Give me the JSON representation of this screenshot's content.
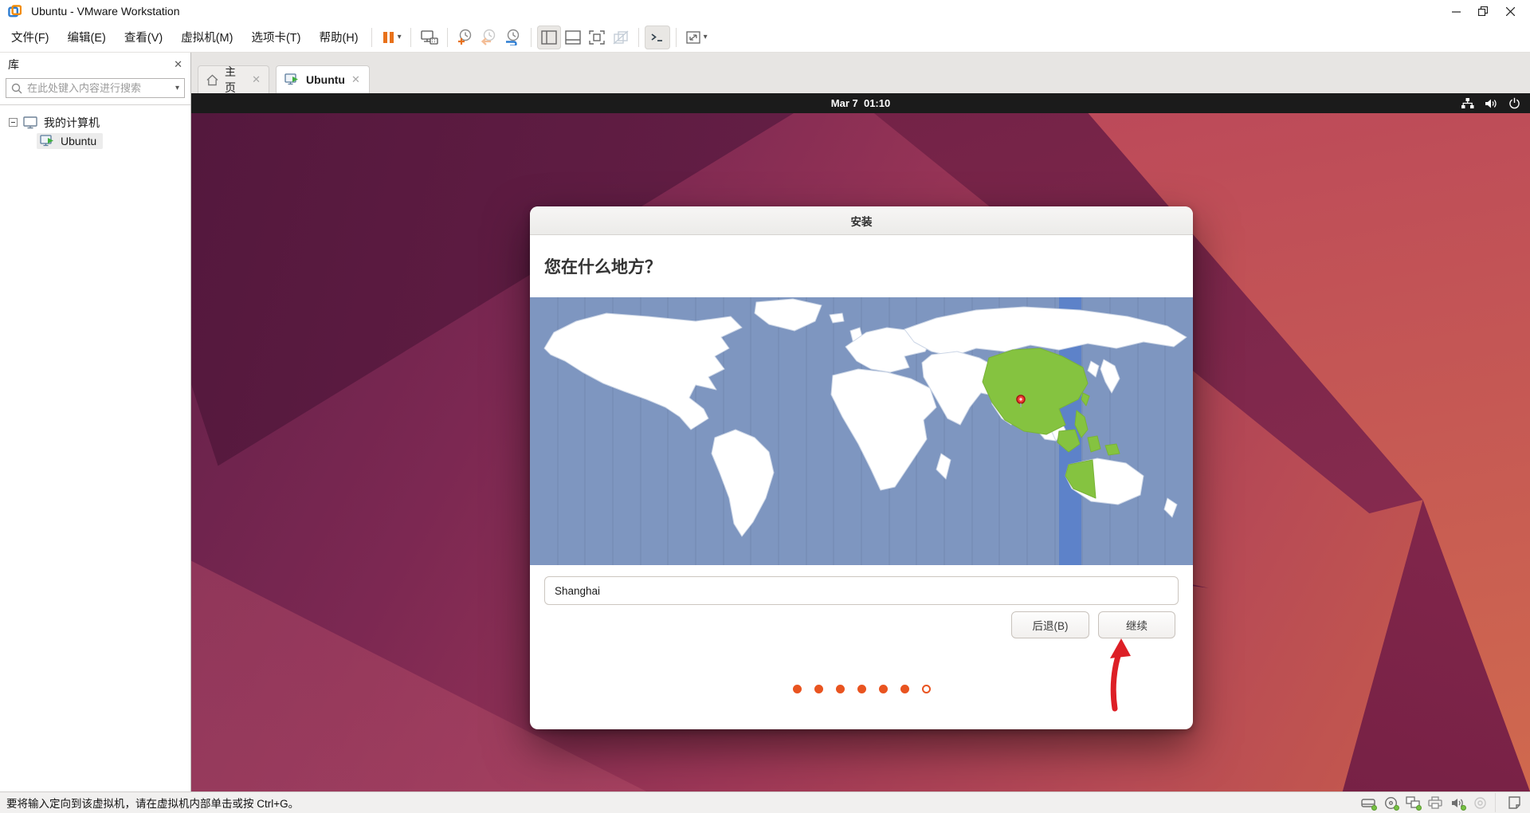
{
  "window": {
    "title": "Ubuntu - VMware Workstation"
  },
  "menubar": {
    "items": [
      {
        "label": "文件(F)"
      },
      {
        "label": "编辑(E)"
      },
      {
        "label": "查看(V)"
      },
      {
        "label": "虚拟机(M)"
      },
      {
        "label": "选项卡(T)"
      },
      {
        "label": "帮助(H)"
      }
    ]
  },
  "sidebar": {
    "title": "库",
    "search_placeholder": "在此处键入内容进行搜索",
    "tree": {
      "root_label": "我的计算机",
      "vm_label": "Ubuntu"
    }
  },
  "tabs": {
    "home_label": "主页",
    "vm_label": "Ubuntu"
  },
  "vm_screen": {
    "clock": "Mar 7  01:10",
    "installer": {
      "window_title": "安装",
      "heading": "您在什么地方？",
      "location_value": "Shanghai",
      "back_button": "后退(B)",
      "continue_button": "继续",
      "progress": {
        "total": 7,
        "completed": 6
      }
    }
  },
  "statusbar": {
    "message": "要将输入定向到该虚拟机，请在虚拟机内部单击或按 Ctrl+G。"
  },
  "icons": {
    "caret": "▾",
    "close": "✕"
  },
  "colors": {
    "ubuntu_orange": "#e95420",
    "toolbar_pause_orange": "#e8711a",
    "map_sea": "#7e96c0",
    "map_land": "#ffffff",
    "map_selected_zone_green": "#85c340",
    "map_timezone_band_blue": "#5d82c9",
    "annotation_arrow_red": "#dd1f26",
    "device_active_green": "#76c043"
  }
}
